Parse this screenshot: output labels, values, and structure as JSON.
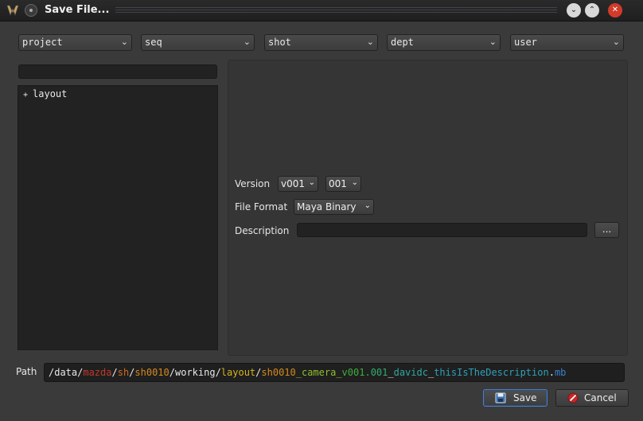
{
  "window": {
    "title": "Save File..."
  },
  "selectors": [
    {
      "value": "project"
    },
    {
      "value": "seq"
    },
    {
      "value": "shot"
    },
    {
      "value": "dept"
    },
    {
      "value": "user"
    }
  ],
  "tree": {
    "items": [
      {
        "label": "layout",
        "expander": "+"
      }
    ]
  },
  "form": {
    "version_label": "Version",
    "version_major": "v001",
    "version_minor": "001",
    "file_format_label": "File Format",
    "file_format_value": "Maya Binary",
    "description_label": "Description",
    "description_value": "",
    "browse_label": "..."
  },
  "path": {
    "label": "Path",
    "segments": [
      {
        "text": "/data/",
        "color": "#e8e8e8"
      },
      {
        "text": "mazda",
        "color": "#c0392b"
      },
      {
        "text": "/",
        "color": "#e8e8e8"
      },
      {
        "text": "sh",
        "color": "#d4691e"
      },
      {
        "text": "/",
        "color": "#e8e8e8"
      },
      {
        "text": "sh0010",
        "color": "#d68a1e"
      },
      {
        "text": "/working/",
        "color": "#e8e8e8"
      },
      {
        "text": "layout",
        "color": "#d6b21e"
      },
      {
        "text": "/",
        "color": "#e8e8e8"
      },
      {
        "text": "sh0010",
        "color": "#d68a1e"
      },
      {
        "text": "_camera_",
        "color": "#8fbf2f"
      },
      {
        "text": "v001",
        "color": "#3fae3f"
      },
      {
        "text": ".",
        "color": "#3fae3f"
      },
      {
        "text": "001",
        "color": "#2fae6f"
      },
      {
        "text": "_",
        "color": "#e8e8e8"
      },
      {
        "text": "davidc",
        "color": "#2fa8a0"
      },
      {
        "text": "_",
        "color": "#e8e8e8"
      },
      {
        "text": "thisIsTheDescription",
        "color": "#2fa0b8"
      },
      {
        "text": ".",
        "color": "#e8e8e8"
      },
      {
        "text": "mb",
        "color": "#3a7fd0"
      }
    ]
  },
  "buttons": {
    "save": "Save",
    "cancel": "Cancel"
  },
  "icons": {
    "app": "app-icon",
    "pin": "pin-icon",
    "minimize": "minimize-icon",
    "maximize": "maximize-icon",
    "close": "close-icon",
    "save": "floppy-disk-icon",
    "cancel": "cancel-icon"
  },
  "colors": {
    "accent": "#4d7fc0",
    "close": "#d23a2a"
  }
}
